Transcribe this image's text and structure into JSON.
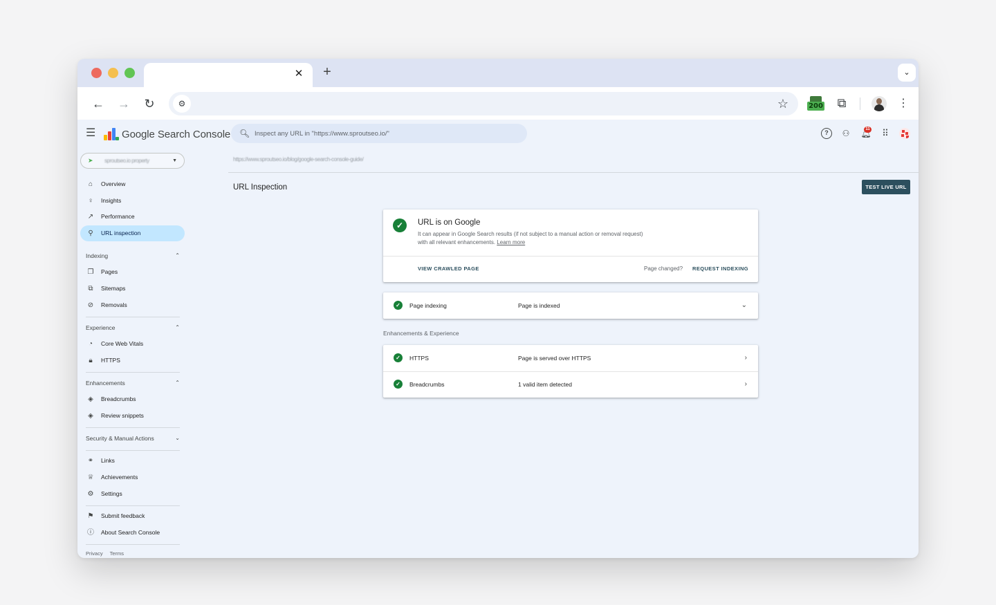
{
  "browser": {
    "tab_close": "✕",
    "new_tab": "+",
    "tab_menu": "⌄",
    "nav": {
      "back": "←",
      "forward": "→",
      "reload": "↻"
    },
    "omnibox_value": "",
    "extension_badge": "200"
  },
  "app": {
    "title": "Google Search Console",
    "search_placeholder": "Inspect any URL in \"https://www.sproutseo.io/\"",
    "notification_count": "11",
    "property_label": "sproutseo.io property"
  },
  "sidebar": {
    "top_items": [
      {
        "label": "Overview",
        "icon": "home-icon"
      },
      {
        "label": "Insights",
        "icon": "bulb-icon"
      },
      {
        "label": "Performance",
        "icon": "trending-up-icon"
      },
      {
        "label": "URL inspection",
        "icon": "search-icon",
        "active": true
      }
    ],
    "sections": [
      {
        "label": "Indexing",
        "expanded": true,
        "items": [
          "Pages",
          "Sitemaps",
          "Removals"
        ]
      },
      {
        "label": "Experience",
        "expanded": true,
        "items": [
          "Core Web Vitals",
          "HTTPS"
        ]
      },
      {
        "label": "Enhancements",
        "expanded": true,
        "items": [
          "Breadcrumbs",
          "Review snippets"
        ]
      },
      {
        "label": "Security & Manual Actions",
        "expanded": false,
        "items": []
      }
    ],
    "bottom_items": [
      "Links",
      "Achievements",
      "Settings"
    ],
    "footer_items": [
      "Submit feedback",
      "About Search Console"
    ],
    "legal": [
      "Privacy",
      "Terms"
    ]
  },
  "main": {
    "breadcrumb": "https://www.sproutseo.io/blog/google-search-console-guide/",
    "page_title": "URL Inspection",
    "test_live_label": "TEST LIVE URL",
    "status": {
      "title": "URL is on Google",
      "description": "It can appear in Google Search results (if not subject to a manual action or removal request) with all relevant enhancements.",
      "learn_more": "Learn more",
      "view_crawled": "VIEW CRAWLED PAGE",
      "page_changed": "Page changed?",
      "request_indexing": "REQUEST INDEXING"
    },
    "indexing": {
      "name": "Page indexing",
      "value": "Page is indexed"
    },
    "enhancements_label": "Enhancements & Experience",
    "enhancements": [
      {
        "name": "HTTPS",
        "value": "Page is served over HTTPS"
      },
      {
        "name": "Breadcrumbs",
        "value": "1 valid item detected"
      }
    ]
  },
  "colors": {
    "accent": "#2c4f5e",
    "success": "#188038",
    "active_nav": "#c2e7ff",
    "page_bg": "#eef3fb"
  }
}
